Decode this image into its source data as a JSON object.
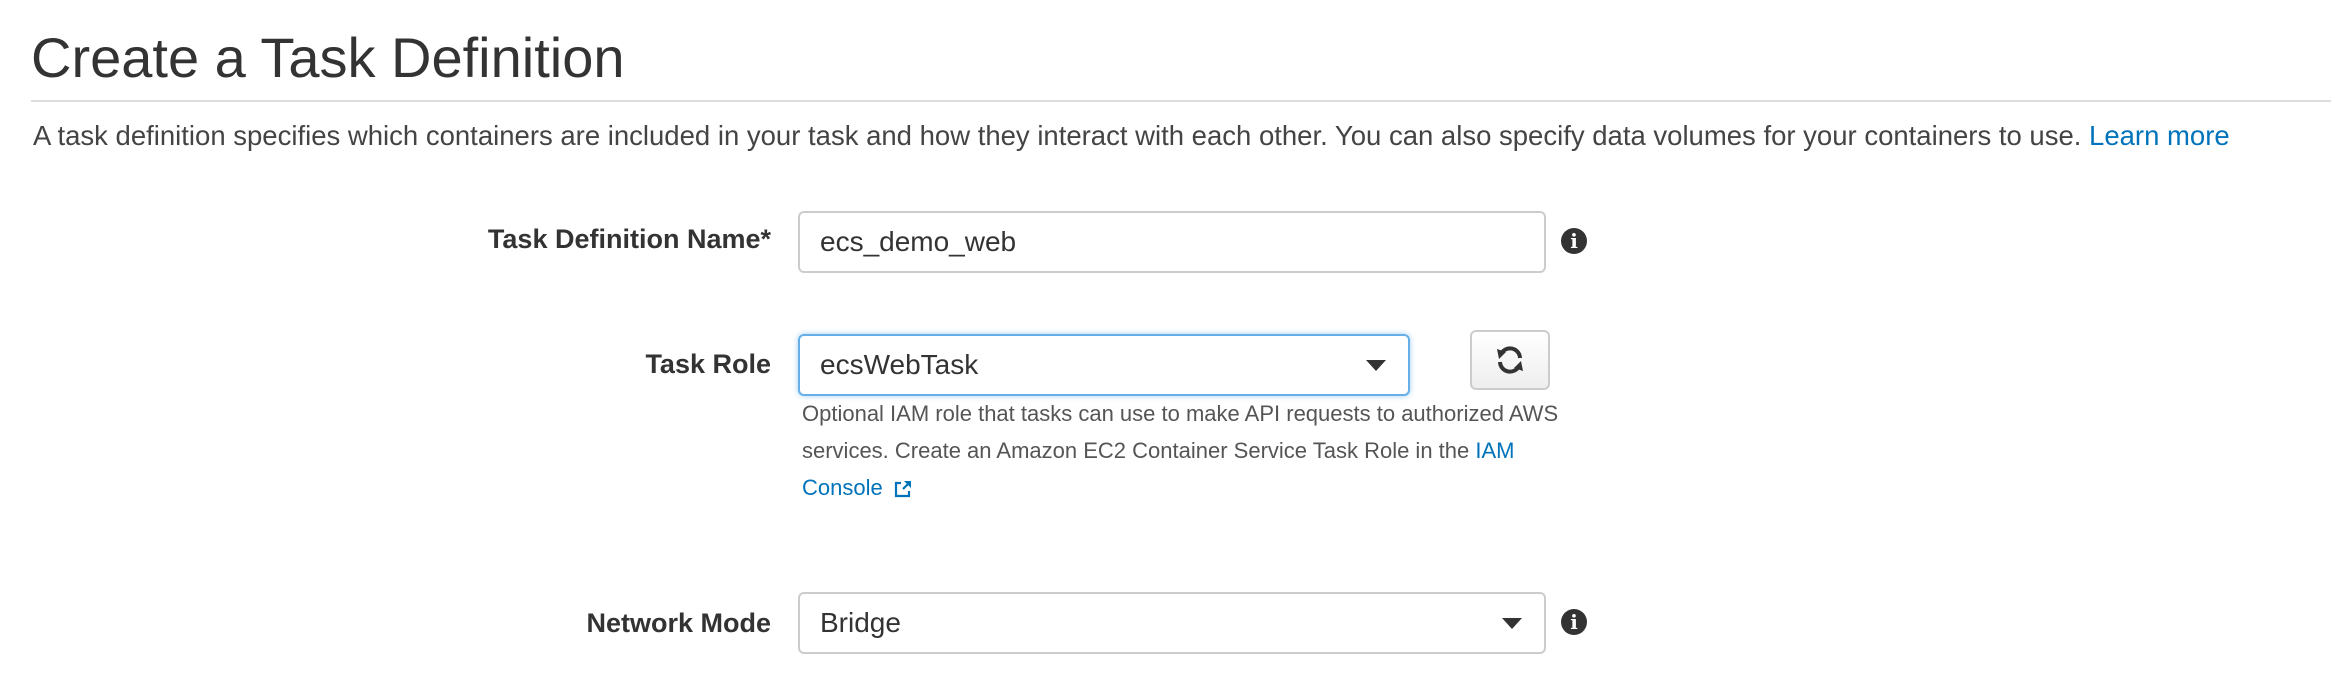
{
  "page": {
    "title": "Create a Task Definition",
    "description": "A task definition specifies which containers are included in your task and how they interact with each other. You can also specify data volumes for your containers to use.",
    "learn_more": "Learn more"
  },
  "form": {
    "task_definition_name": {
      "label": "Task Definition Name*",
      "value": "ecs_demo_web"
    },
    "task_role": {
      "label": "Task Role",
      "value": "ecsWebTask",
      "help_text": "Optional IAM role that tasks can use to make API requests to authorized AWS services. Create an Amazon EC2 Container Service Task Role in the",
      "help_link": "IAM Console"
    },
    "network_mode": {
      "label": "Network Mode",
      "value": "Bridge"
    }
  },
  "icons": {
    "info": "info-icon",
    "refresh": "refresh-icon",
    "dropdown": "caret-down-icon",
    "external_link": "external-link-icon"
  },
  "colors": {
    "link": "#0073bb",
    "focus_border": "#66afe9",
    "text": "#333333"
  }
}
